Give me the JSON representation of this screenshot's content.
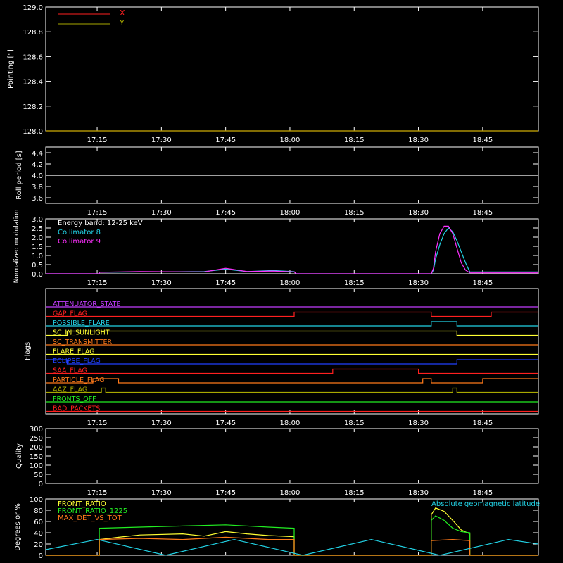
{
  "time_axis": {
    "tick_labels": [
      "17:15",
      "17:30",
      "17:45",
      "18:00",
      "18:15",
      "18:30",
      "18:45"
    ],
    "tick_minutes": [
      1035,
      1050,
      1065,
      1080,
      1095,
      1110,
      1125
    ],
    "range_minutes": [
      1023,
      1138
    ]
  },
  "colors": {
    "background": "#000000",
    "axes": "#ffffff",
    "red": "#ff2020",
    "olive": "#a8a800",
    "cyan": "#22d3e6",
    "magenta": "#ff30ff",
    "purple": "#c43cff",
    "orange": "#ff7a1a",
    "yellow": "#ffff33",
    "blue": "#2040ff",
    "green": "#22ee22",
    "white": "#ffffff"
  },
  "chart_data": [
    {
      "type": "line",
      "id": "pointing",
      "ylabel": "Pointing [\"]",
      "ylim": [
        128.0,
        129.0
      ],
      "yticks": [
        "128.0",
        "128.2",
        "128.4",
        "128.6",
        "128.8",
        "129.0"
      ],
      "ytick_values": [
        128.0,
        128.2,
        128.4,
        128.6,
        128.8,
        129.0
      ],
      "legend": [
        "X",
        "Y"
      ],
      "series": [
        {
          "name": "X",
          "color": "red",
          "x": [
            1023,
            1138
          ],
          "values": [
            128.0,
            128.0
          ]
        },
        {
          "name": "Y",
          "color": "olive",
          "x": [
            1023,
            1138
          ],
          "values": [
            128.0,
            128.0
          ]
        }
      ]
    },
    {
      "type": "line",
      "id": "roll",
      "ylabel": "Roll period [s]",
      "ylim": [
        3.5,
        4.5
      ],
      "yticks": [
        "3.6",
        "3.8",
        "4.0",
        "4.2",
        "4.4"
      ],
      "ytick_values": [
        3.6,
        3.8,
        4.0,
        4.2,
        4.4
      ],
      "series": [
        {
          "color": "white",
          "x": [
            1023,
            1138
          ],
          "values": [
            4.0,
            4.0
          ]
        }
      ]
    },
    {
      "type": "line",
      "id": "modulation",
      "ylabel": "Normalized modulation",
      "ylim": [
        0,
        3.0
      ],
      "yticks": [
        "0.0",
        "0.5",
        "1.0",
        "1.5",
        "2.0",
        "2.5",
        "3.0"
      ],
      "ytick_values": [
        0,
        0.5,
        1.0,
        1.5,
        2.0,
        2.5,
        3.0
      ],
      "legend_header": "Energy band: 12-25 keV",
      "series": [
        {
          "name": "Collimator 8",
          "color": "cyan",
          "x": [
            1023,
            1035.5,
            1035.5,
            1045,
            1060,
            1065,
            1070,
            1076,
            1081,
            1081.5,
            1113,
            1113.5,
            1114,
            1115,
            1116,
            1117,
            1118,
            1119,
            1120,
            1121,
            1122,
            1138
          ],
          "values": [
            0,
            0,
            0.08,
            0.1,
            0.12,
            0.25,
            0.12,
            0.18,
            0.12,
            0,
            0,
            0.2,
            0.8,
            1.6,
            2.2,
            2.5,
            2.3,
            1.8,
            1.2,
            0.6,
            0.1,
            0.1
          ]
        },
        {
          "name": "Collimator 9",
          "color": "magenta",
          "x": [
            1023,
            1035.5,
            1035.5,
            1045,
            1060,
            1065,
            1070,
            1076,
            1081,
            1081.5,
            1113,
            1113.5,
            1114,
            1115,
            1116,
            1117,
            1118,
            1119,
            1120,
            1121,
            1122,
            1138
          ],
          "values": [
            0,
            0,
            0.08,
            0.12,
            0.1,
            0.3,
            0.12,
            0.15,
            0.1,
            0,
            0,
            0.3,
            1.2,
            2.2,
            2.6,
            2.6,
            2.2,
            1.4,
            0.6,
            0.2,
            0.05,
            0.05
          ]
        }
      ]
    },
    {
      "type": "line",
      "id": "flags",
      "ylabel": "Flags",
      "series": [
        {
          "name": "ATTENUATOR_STATE",
          "color": "purple",
          "x": [
            1023,
            1138
          ],
          "values": [
            0,
            0
          ]
        },
        {
          "name": "GAP_FLAG",
          "color": "red",
          "x": [
            1023,
            1081,
            1081,
            1113,
            1113,
            1127,
            1127,
            1138
          ],
          "values": [
            0,
            0,
            1,
            1,
            0,
            0,
            1,
            1
          ]
        },
        {
          "name": "POSSIBLE_FLARE",
          "color": "cyan",
          "x": [
            1023,
            1113,
            1113,
            1119,
            1119,
            1138
          ],
          "values": [
            0,
            0,
            1,
            1,
            0,
            0
          ]
        },
        {
          "name": "SC_IN_SUNLIGHT",
          "color": "yellow",
          "x": [
            1023,
            1028,
            1028,
            1119,
            1119,
            1138
          ],
          "values": [
            0,
            0,
            1,
            1,
            0,
            0
          ]
        },
        {
          "name": "SC_TRANSMITTER",
          "color": "orange",
          "x": [
            1023,
            1138
          ],
          "values": [
            0,
            0
          ]
        },
        {
          "name": "FLARE_FLAG",
          "color": "yellow",
          "x": [
            1023,
            1138
          ],
          "values": [
            0,
            0
          ]
        },
        {
          "name": "ECLIPSE_FLAG",
          "color": "blue",
          "x": [
            1023,
            1028,
            1028,
            1119,
            1119,
            1138
          ],
          "values": [
            1,
            1,
            0,
            0,
            1,
            1
          ]
        },
        {
          "name": "SAA_FLAG",
          "color": "red",
          "x": [
            1023,
            1090,
            1090,
            1110,
            1110,
            1138
          ],
          "values": [
            0,
            0,
            1,
            1,
            0,
            0
          ]
        },
        {
          "name": "PARTICLE_FLAG",
          "color": "orange",
          "x": [
            1023,
            1034,
            1034,
            1040,
            1040,
            1111,
            1111,
            1113,
            1113,
            1125,
            1125,
            1138
          ],
          "values": [
            0,
            0,
            1,
            1,
            0,
            0,
            1,
            1,
            0,
            0,
            1,
            1
          ]
        },
        {
          "name": "AAZ_FLAG",
          "color": "olive",
          "x": [
            1023,
            1036,
            1036,
            1037,
            1037,
            1118,
            1118,
            1119,
            1119,
            1138
          ],
          "values": [
            0,
            0,
            1,
            1,
            0,
            0,
            1,
            1,
            0,
            0
          ]
        },
        {
          "name": "FRONTS_OFF",
          "color": "green",
          "x": [
            1023,
            1138
          ],
          "values": [
            0,
            0
          ]
        },
        {
          "name": "BAD_PACKETS",
          "color": "red",
          "x": [
            1023,
            1138
          ],
          "values": [
            0,
            0
          ]
        }
      ]
    },
    {
      "type": "line",
      "id": "quality",
      "ylabel": "Quality",
      "ylim": [
        0,
        300
      ],
      "yticks": [
        "0",
        "50",
        "100",
        "150",
        "200",
        "250",
        "300"
      ],
      "ytick_values": [
        0,
        50,
        100,
        150,
        200,
        250,
        300
      ],
      "series": []
    },
    {
      "type": "line",
      "id": "ratios",
      "ylabel": "Degrees or %",
      "ylim": [
        0,
        100
      ],
      "yticks": [
        "0",
        "20",
        "40",
        "60",
        "80",
        "100"
      ],
      "ytick_values": [
        0,
        20,
        40,
        60,
        80,
        100
      ],
      "annotation": "Absolute geomagnetic latitude",
      "series": [
        {
          "name": "FRONT_RATIO",
          "color": "yellow",
          "x": [
            1023,
            1035.5,
            1035.5,
            1040,
            1045,
            1055,
            1060,
            1065,
            1070,
            1075,
            1081,
            1081,
            1113,
            1113,
            1114,
            1116,
            1118,
            1120,
            1122,
            1122,
            1138
          ],
          "values": [
            0,
            0,
            28,
            32,
            36,
            38,
            34,
            42,
            38,
            35,
            33,
            0,
            0,
            72,
            84,
            78,
            62,
            45,
            38,
            0,
            0
          ]
        },
        {
          "name": "FRONT_RATIO_1225",
          "color": "green",
          "x": [
            1023,
            1035.5,
            1035.5,
            1045,
            1055,
            1065,
            1075,
            1081,
            1081,
            1113,
            1113,
            1114,
            1116,
            1118,
            1120,
            1122,
            1122,
            1138
          ],
          "values": [
            0,
            0,
            48,
            50,
            52,
            54,
            50,
            48,
            0,
            0,
            62,
            70,
            62,
            48,
            42,
            40,
            0,
            0
          ]
        },
        {
          "name": "MAX_DET_VS_TOT",
          "color": "orange",
          "x": [
            1023,
            1035.5,
            1035.5,
            1045,
            1055,
            1065,
            1075,
            1081,
            1081,
            1113,
            1113,
            1118,
            1122,
            1122,
            1138
          ],
          "values": [
            0,
            0,
            28,
            30,
            28,
            32,
            28,
            28,
            0,
            0,
            26,
            28,
            26,
            0,
            0
          ]
        },
        {
          "name": "Absolute geomagnetic latitude",
          "color": "cyan",
          "x": [
            1023,
            1035,
            1051,
            1067,
            1083,
            1099,
            1115,
            1131,
            1138
          ],
          "values": [
            10,
            28,
            0,
            28,
            0,
            28,
            0,
            28,
            20
          ]
        }
      ]
    }
  ]
}
